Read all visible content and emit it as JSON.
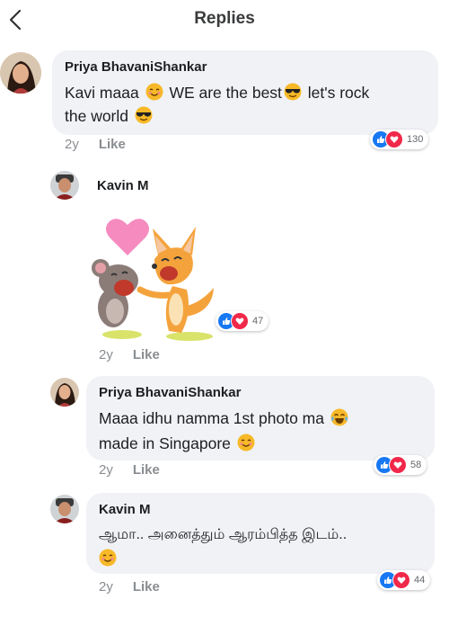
{
  "header": {
    "title": "Replies"
  },
  "comments": [
    {
      "author": "Priya BhavaniShankar",
      "line1_a": "Kavi maaa",
      "line1_b": "WE are the best",
      "line1_c": "let's rock",
      "line2": "the world",
      "time": "2y",
      "like": "Like",
      "reactions": "130"
    },
    {
      "author": "Kavin M",
      "time": "2y",
      "like": "Like",
      "reactions": "47"
    },
    {
      "author": "Priya BhavaniShankar",
      "line1": "Maaa idhu namma 1st photo ma",
      "line2": "made in Singapore",
      "time": "2y",
      "like": "Like",
      "reactions": "58"
    },
    {
      "author": "Kavin M",
      "line1": "ஆமா.. அனைத்தும் ஆரம்பித்த இடம்..",
      "time": "2y",
      "like": "Like",
      "reactions": "44"
    }
  ],
  "icons": {
    "back": "chevron-left-icon",
    "smile": "smiling-face-emoji",
    "sunglasses": "sunglasses-face-emoji",
    "laugh": "tears-of-joy-emoji",
    "like": "thumbs-up-reaction-icon",
    "love": "heart-reaction-icon"
  },
  "colors": {
    "bubble": "#f0f2f5",
    "like_blue": "#1877f2",
    "love_red": "#f02849",
    "meta_gray": "#8a8d91"
  }
}
